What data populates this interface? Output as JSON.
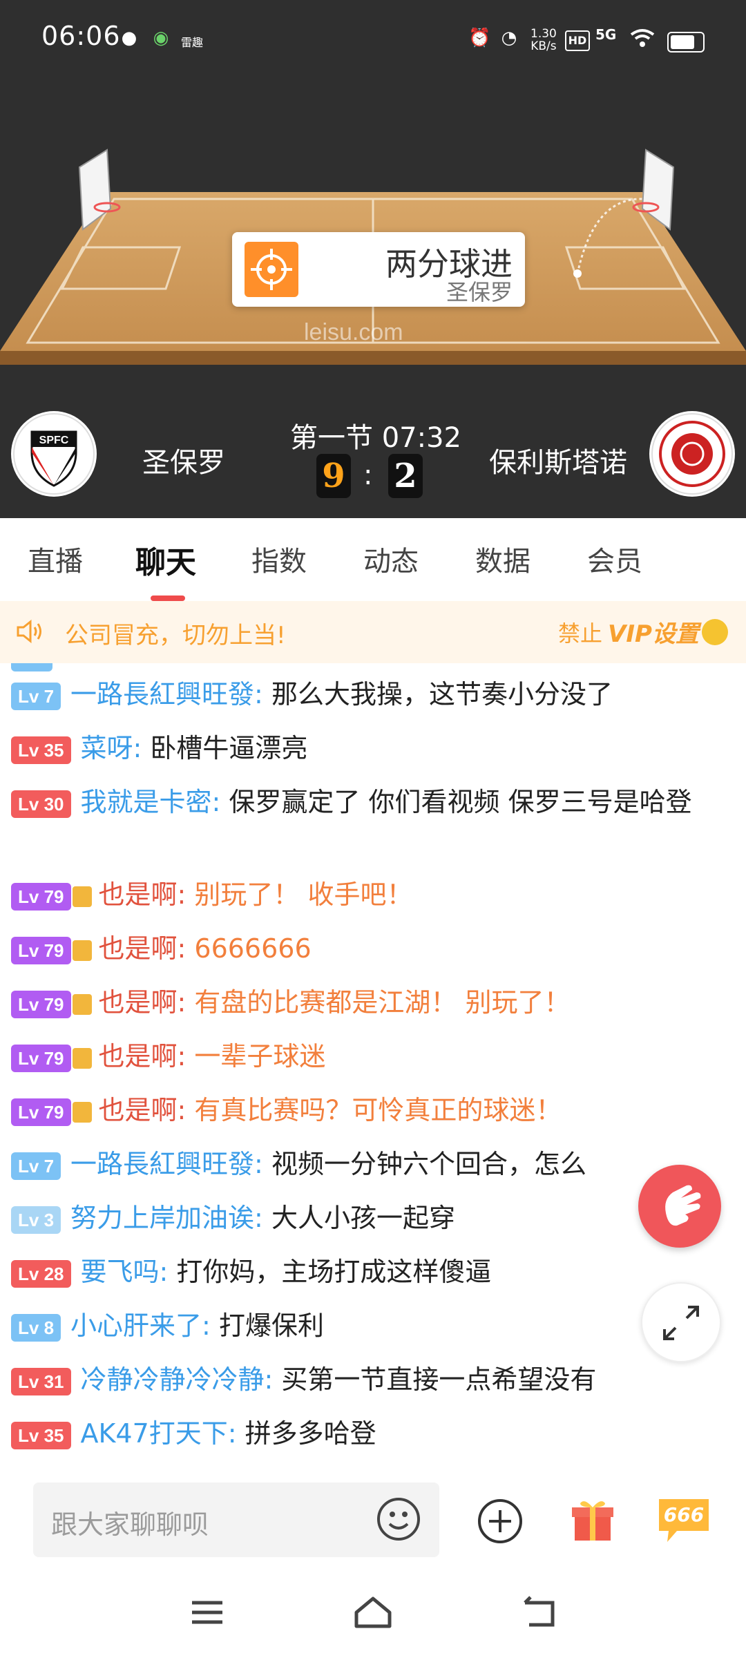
{
  "status_bar": {
    "time": "06:06",
    "carrier_label": "雷趣",
    "net_speed": "1.30",
    "net_speed_unit": "KB/s",
    "hd_label": "HD",
    "signal_label": "5G",
    "icons": [
      "globe-icon",
      "app-icon",
      "alarm-icon",
      "speedometer-icon",
      "wifi-icon",
      "battery-icon"
    ]
  },
  "court": {
    "watermark": "leisu.com",
    "event": {
      "title": "两分球进",
      "team": "圣保罗",
      "icon": "target-icon"
    }
  },
  "scoreboard": {
    "home_name": "圣保罗",
    "away_name": "保利斯塔诺",
    "home_logo_text": "SPFC",
    "period_time": "第一节 07:32",
    "home_score": "9",
    "away_score": "2",
    "separator": ":"
  },
  "tabs": [
    {
      "label": "直播"
    },
    {
      "label": "聊天",
      "active": true
    },
    {
      "label": "指数"
    },
    {
      "label": "动态"
    },
    {
      "label": "数据"
    },
    {
      "label": "会员"
    }
  ],
  "notice": {
    "text": "公司冒充，切勿上当!",
    "ban_label": "禁止",
    "vip_setting": "VIP设置"
  },
  "chat_messages": [
    {
      "level": "Lv 7",
      "badge": "blue",
      "user": "一路長紅興旺發:",
      "text": "那么大我操，这节奏小分没了"
    },
    {
      "level": "Lv 35",
      "badge": "red",
      "user": "菜呀:",
      "text": "卧槽牛逼漂亮"
    },
    {
      "level": "Lv 30",
      "badge": "red",
      "user": "我就是卡密:",
      "text": "保罗赢定了 你们看视频 保罗三号是哈登"
    },
    {
      "level": "Lv 79",
      "badge": "purple",
      "user": "也是啊:",
      "text": "别玩了！ 收手吧！",
      "vip": true
    },
    {
      "level": "Lv 79",
      "badge": "purple",
      "user": "也是啊:",
      "text": "6666666",
      "vip": true
    },
    {
      "level": "Lv 79",
      "badge": "purple",
      "user": "也是啊:",
      "text": "有盘的比赛都是江湖！ 别玩了！",
      "vip": true
    },
    {
      "level": "Lv 79",
      "badge": "purple",
      "user": "也是啊:",
      "text": "一辈子球迷",
      "vip": true
    },
    {
      "level": "Lv 79",
      "badge": "purple",
      "user": "也是啊:",
      "text": "有真比赛吗？可怜真正的球迷！",
      "vip": true
    },
    {
      "level": "Lv 7",
      "badge": "blue",
      "user": "一路長紅興旺發:",
      "text": "视频一分钟六个回合，怎么"
    },
    {
      "level": "Lv 3",
      "badge": "lightblue",
      "user": "努力上岸加油诶:",
      "text": "大人小孩一起穿"
    },
    {
      "level": "Lv 28",
      "badge": "red",
      "user": "要飞吗:",
      "text": "打你妈，主场打成这样傻逼"
    },
    {
      "level": "Lv 8",
      "badge": "blue",
      "user": "小心肝来了:",
      "text": "打爆保利"
    },
    {
      "level": "Lv 31",
      "badge": "red",
      "user": "冷静冷静冷冷静:",
      "text": "买第一节直接一点希望没有"
    },
    {
      "level": "Lv 35",
      "badge": "red",
      "user": "AK47打天下:",
      "text": "拼多多哈登"
    }
  ],
  "input": {
    "placeholder": "跟大家聊聊呗",
    "sixsix_label": "666"
  },
  "colors": {
    "accent_red": "#ef4b4b",
    "notice_orange": "#f7a030",
    "username_blue": "#3a9ce8",
    "home_score_orange": "#ffa31a"
  }
}
